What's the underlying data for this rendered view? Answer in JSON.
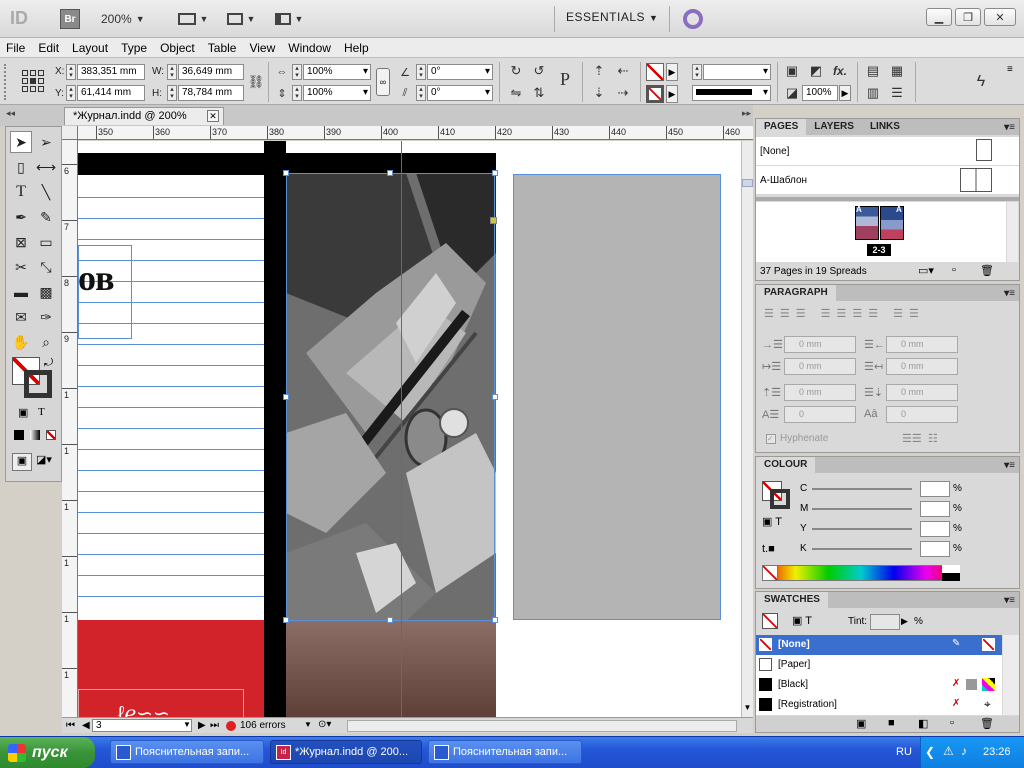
{
  "app": {
    "logo": "ID",
    "bridge": "Br",
    "zoom": "200%",
    "workspace": "ESSENTIALS",
    "window_controls": [
      "minimize-icon",
      "restore-icon",
      "close-icon"
    ]
  },
  "menu": [
    "File",
    "Edit",
    "Layout",
    "Type",
    "Object",
    "Table",
    "View",
    "Window",
    "Help"
  ],
  "control": {
    "x_label": "X:",
    "x": "383,351 mm",
    "y_label": "Y:",
    "y": "61,414 mm",
    "w_label": "W:",
    "w": "36,649 mm",
    "h_label": "H:",
    "h": "78,784 mm",
    "scale_x": "100%",
    "scale_y": "100%",
    "rotate": "0°",
    "shear": "0°",
    "stroke_weight_value": "",
    "opacity": "100%"
  },
  "document": {
    "tab_title": "*Журнал.indd @ 200%",
    "partial_heading": "ов",
    "ruler_h": [
      "350",
      "360",
      "370",
      "380",
      "390",
      "400",
      "410",
      "420",
      "430",
      "440",
      "450",
      "460"
    ],
    "ruler_v": [
      "6",
      "7",
      "8",
      "9",
      "1",
      "1",
      "1",
      "1",
      "1",
      "1",
      "1"
    ]
  },
  "status": {
    "page": "3",
    "errors": "106 errors"
  },
  "pages_panel": {
    "tabs": [
      "PAGES",
      "LAYERS",
      "LINKS"
    ],
    "master_none": "[None]",
    "master_a": "А-Шаблон",
    "spread_label": "2-3",
    "summary": "37 Pages in 19 Spreads"
  },
  "paragraph_panel": {
    "title": "PARAGRAPH",
    "left_indent": "0 mm",
    "right_indent": "0 mm",
    "first_indent": "0 mm",
    "last_indent": "0 mm",
    "space_before": "0 mm",
    "space_after": "0 mm",
    "drop_lines": "0",
    "drop_chars": "0",
    "hyphenate": "Hyphenate"
  },
  "colour_panel": {
    "title": "COLOUR",
    "channels": [
      "C",
      "M",
      "Y",
      "K"
    ],
    "percent": "%"
  },
  "swatches_panel": {
    "title": "SWATCHES",
    "tint_label": "Tint:",
    "tint_value": "",
    "percent": "%",
    "items": [
      "[None]",
      "[Paper]",
      "[Black]",
      "[Registration]"
    ]
  },
  "taskbar": {
    "start": "пуск",
    "tasks": [
      "Пояснительная запи...",
      "*Журнал.indd @ 200...",
      "Пояснительная запи..."
    ],
    "lang": "RU",
    "time": "23:26"
  },
  "colors": {
    "accent_selected": "#3a6fd0",
    "red_page": "#d2232a",
    "frame_purple": "#7a4ccf"
  }
}
